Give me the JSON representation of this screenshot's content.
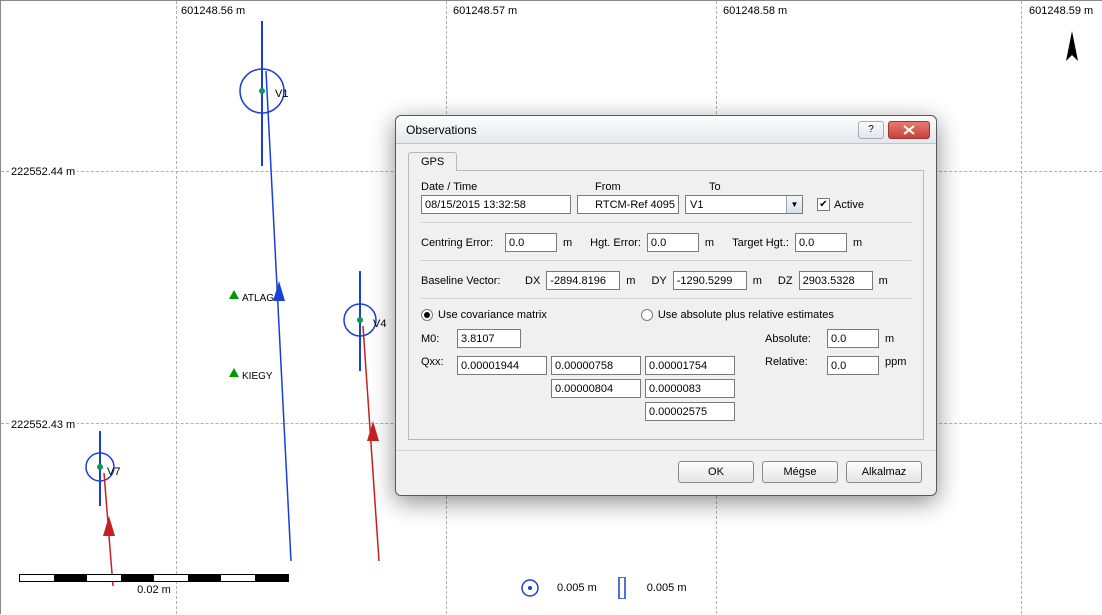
{
  "canvas": {
    "x_labels": [
      "601248.56 m",
      "601248.57 m",
      "601248.58 m",
      "601248.59 m"
    ],
    "y_labels": [
      "222552.44 m",
      "222552.43 m"
    ],
    "points": {
      "v1": "V1",
      "v4": "V4",
      "v7": "V7",
      "atlag": "ATLAG",
      "kiegy": "KIEGY"
    }
  },
  "legend": {
    "scale_label": "0.02 m",
    "circle": "0.005 m",
    "bar": "0.005 m"
  },
  "dialog": {
    "title": "Observations",
    "tab": "GPS",
    "headers": {
      "datetime": "Date / Time",
      "from": "From",
      "to": "To"
    },
    "values": {
      "datetime": "08/15/2015 13:32:58",
      "from": "RTCM-Ref 4095",
      "to": "V1"
    },
    "active_label": "Active",
    "row_errors": {
      "centring_label": "Centring Error:",
      "centring_value": "0.0",
      "m": "m",
      "hgt_label": "Hgt. Error:",
      "hgt_value": "0.0",
      "target_label": "Target Hgt.:",
      "target_value": "0.0"
    },
    "baseline": {
      "label": "Baseline Vector:",
      "dx_label": "DX",
      "dx": "-2894.8196",
      "dy_label": "DY",
      "dy": "-1290.5299",
      "dz_label": "DZ",
      "dz": "2903.5328"
    },
    "radios": {
      "cov": "Use covariance matrix",
      "abs": "Use absolute plus relative estimates"
    },
    "m0_label": "M0:",
    "m0": "3.8107",
    "abs_label": "Absolute:",
    "abs_value": "0.0",
    "rel_label": "Relative:",
    "rel_value": "0.0",
    "ppm": "ppm",
    "qxx_label": "Qxx:",
    "qxx": [
      "0.00001944",
      "0.00000758",
      "0.00001754",
      "0.00000804",
      "0.0000083",
      "0.00002575"
    ],
    "buttons": {
      "ok": "OK",
      "cancel": "Mégse",
      "apply": "Alkalmaz"
    }
  }
}
